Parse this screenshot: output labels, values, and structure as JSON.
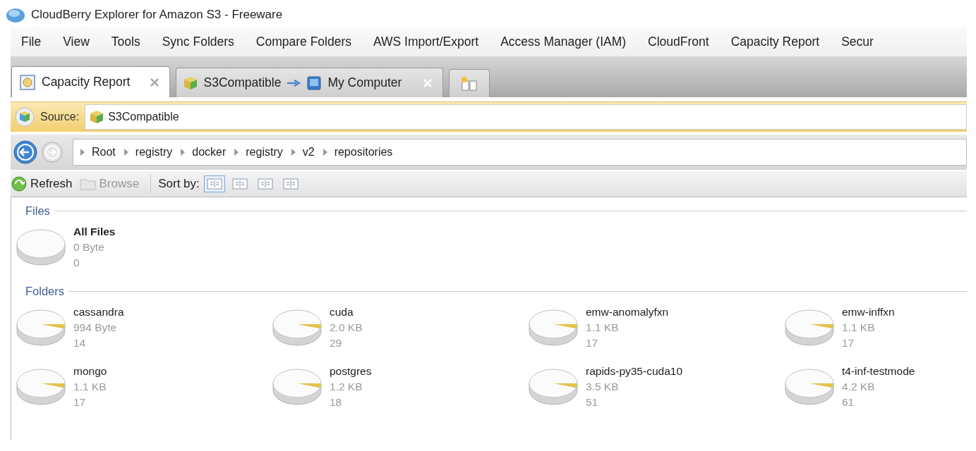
{
  "window": {
    "title": "CloudBerry Explorer for Amazon S3 - Freeware"
  },
  "menu": [
    "File",
    "View",
    "Tools",
    "Sync Folders",
    "Compare Folders",
    "AWS Import/Export",
    "Access Manager (IAM)",
    "CloudFront",
    "Capacity Report",
    "Secur"
  ],
  "tabs": [
    {
      "kind": "single",
      "label": "Capacity Report",
      "selected": true
    },
    {
      "kind": "pair",
      "source": "S3Compatible",
      "target": "My Computer",
      "selected": false
    }
  ],
  "source": {
    "label": "Source:",
    "value": "S3Compatible"
  },
  "breadcrumb": [
    "Root",
    "registry",
    "docker",
    "registry",
    "v2",
    "repositories"
  ],
  "toolbar": {
    "refresh": "Refresh",
    "browse": "Browse",
    "browse_disabled": true,
    "sort_label": "Sort by:",
    "sort_options": [
      {
        "selected": true
      },
      {
        "selected": false
      },
      {
        "selected": false
      },
      {
        "selected": false
      }
    ]
  },
  "files": {
    "heading": "Files",
    "items": [
      {
        "name": "All Files",
        "size": "0 Byte",
        "count": "0"
      }
    ]
  },
  "folders": {
    "heading": "Folders",
    "items": [
      {
        "name": "cassandra",
        "size": "994 Byte",
        "count": "14"
      },
      {
        "name": "cuda",
        "size": "2.0 KB",
        "count": "29"
      },
      {
        "name": "emw-anomalyfxn",
        "size": "1.1 KB",
        "count": "17"
      },
      {
        "name": "emw-inffxn",
        "size": "1.1 KB",
        "count": "17"
      },
      {
        "name": "mongo",
        "size": "1.1 KB",
        "count": "17"
      },
      {
        "name": "postgres",
        "size": "1.2 KB",
        "count": "18"
      },
      {
        "name": "rapids-py35-cuda10",
        "size": "3.5 KB",
        "count": "51"
      },
      {
        "name": "t4-inf-testmode",
        "size": "4.2 KB",
        "count": "61"
      }
    ]
  }
}
